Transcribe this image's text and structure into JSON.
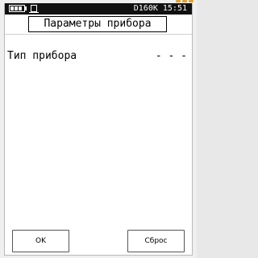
{
  "status_bar": {
    "battery_icon": "battery-icon",
    "storage_icon": "memory-card-icon",
    "text": "D160K 15:51"
  },
  "title": "Параметры прибора",
  "parameters": [
    {
      "label": "Тип прибора",
      "value": "- - -"
    }
  ],
  "softkeys": {
    "left": "OK",
    "right": "Сброс"
  },
  "colors": {
    "status_bar_bg": "#111111",
    "screen_bg": "#ffffff",
    "accent_dots": "#e0a030"
  }
}
